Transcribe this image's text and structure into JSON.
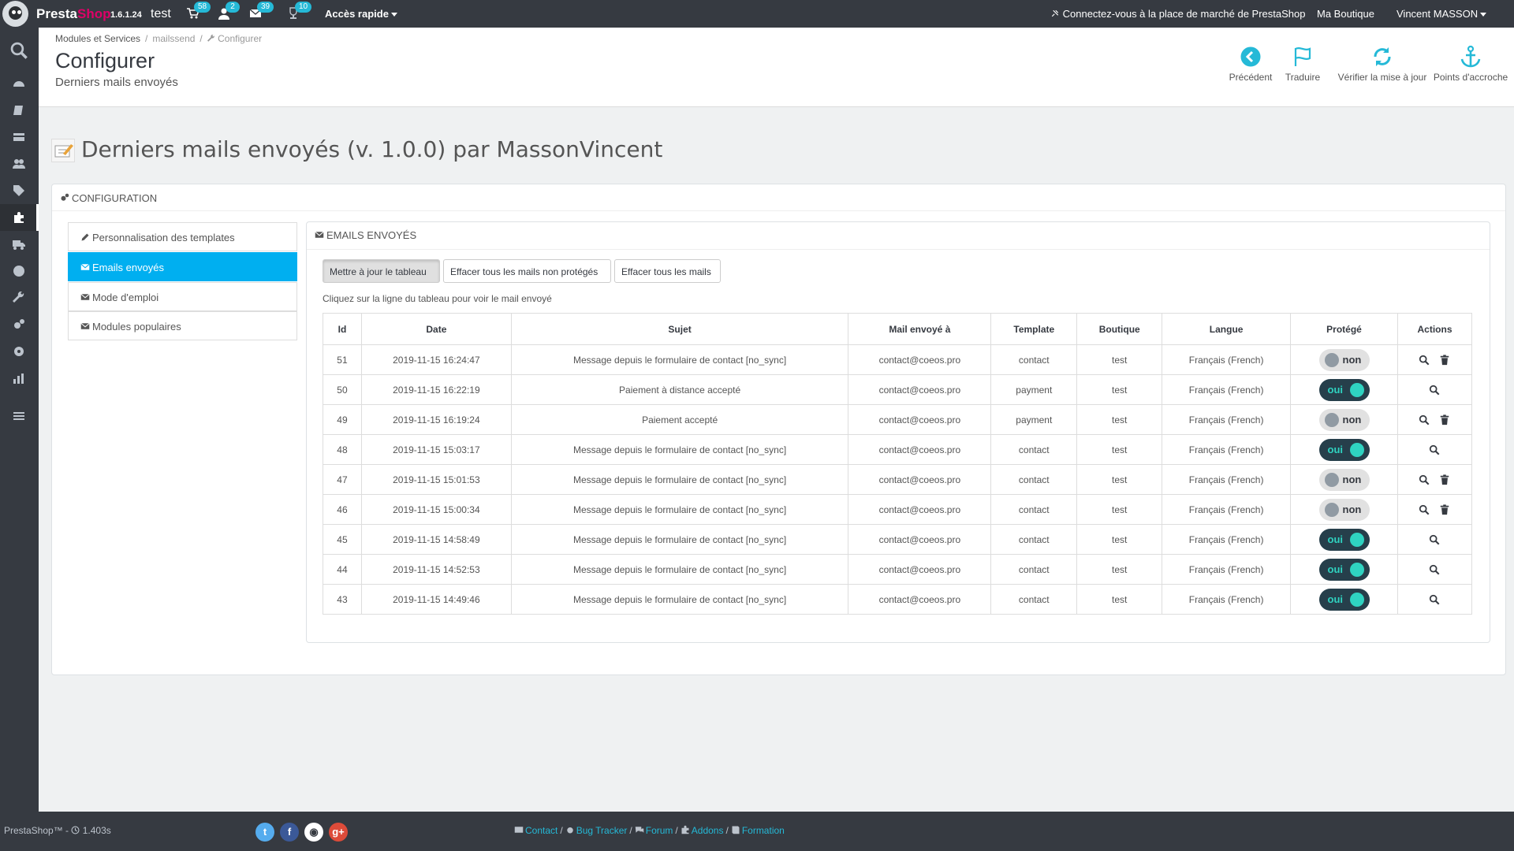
{
  "topbar": {
    "brand_a": "Presta",
    "brand_b": "Shop",
    "version": "1.6.1.24",
    "shop": "test",
    "badges": {
      "orders": "58",
      "customers": "2",
      "messages": "39",
      "trophies": "10"
    },
    "quick_access": "Accès rapide",
    "marketplace": "Connectez-vous à la place de marché de PrestaShop",
    "my_shop": "Ma Boutique",
    "user": "Vincent MASSON"
  },
  "sidebar": {
    "icons": [
      "search-icon",
      "dashboard-icon",
      "orders-icon",
      "catalog-icon",
      "customers-icon",
      "price-rules-icon",
      "modules-icon",
      "shipping-icon",
      "localization-icon",
      "preferences-icon",
      "advanced-params-icon",
      "admin-icon",
      "stats-icon",
      "collapse-menu-icon"
    ]
  },
  "breadcrumb": {
    "root": "Modules et Services",
    "module": "mailssend",
    "current": "Configurer"
  },
  "header": {
    "title": "Configurer",
    "subtitle": "Derniers mails envoyés"
  },
  "toolbar": {
    "back": "Précédent",
    "translate": "Traduire",
    "check_update": "Vérifier la mise à jour",
    "hooks": "Points d'accroche"
  },
  "module_title": "Derniers mails envoyés (v. 1.0.0) par MassonVincent",
  "config_panel": {
    "heading": "CONFIGURATION"
  },
  "menu": [
    {
      "label": "Personnalisation des templates",
      "icon": "pencil-icon"
    },
    {
      "label": "Emails envoyés",
      "icon": "envelope-icon"
    },
    {
      "label": "Mode d'emploi",
      "icon": "envelope-icon"
    },
    {
      "label": "Modules populaires",
      "icon": "envelope-icon"
    }
  ],
  "emails_panel": {
    "heading": "EMAILS ENVOYÉS",
    "btn_refresh": "Mettre à jour le tableau",
    "btn_clear_unprotected": "Effacer tous les mails non protégés",
    "btn_clear_all": "Effacer tous les mails",
    "hint": "Cliquez sur la ligne du tableau pour voir le mail envoyé"
  },
  "table": {
    "headers": [
      "Id",
      "Date",
      "Sujet",
      "Mail envoyé à",
      "Template",
      "Boutique",
      "Langue",
      "Protégé",
      "Actions"
    ],
    "switch_on": "oui",
    "switch_off": "non",
    "rows": [
      {
        "id": "51",
        "date": "2019-11-15 16:24:47",
        "subject": "Message depuis le formulaire de contact [no_sync]",
        "to": "contact@coeos.pro",
        "template": "contact",
        "shop": "test",
        "lang": "Français (French)",
        "protected": false
      },
      {
        "id": "50",
        "date": "2019-11-15 16:22:19",
        "subject": "Paiement à distance accepté",
        "to": "contact@coeos.pro",
        "template": "payment",
        "shop": "test",
        "lang": "Français (French)",
        "protected": true
      },
      {
        "id": "49",
        "date": "2019-11-15 16:19:24",
        "subject": "Paiement accepté",
        "to": "contact@coeos.pro",
        "template": "payment",
        "shop": "test",
        "lang": "Français (French)",
        "protected": false
      },
      {
        "id": "48",
        "date": "2019-11-15 15:03:17",
        "subject": "Message depuis le formulaire de contact [no_sync]",
        "to": "contact@coeos.pro",
        "template": "contact",
        "shop": "test",
        "lang": "Français (French)",
        "protected": true
      },
      {
        "id": "47",
        "date": "2019-11-15 15:01:53",
        "subject": "Message depuis le formulaire de contact [no_sync]",
        "to": "contact@coeos.pro",
        "template": "contact",
        "shop": "test",
        "lang": "Français (French)",
        "protected": false
      },
      {
        "id": "46",
        "date": "2019-11-15 15:00:34",
        "subject": "Message depuis le formulaire de contact [no_sync]",
        "to": "contact@coeos.pro",
        "template": "contact",
        "shop": "test",
        "lang": "Français (French)",
        "protected": false
      },
      {
        "id": "45",
        "date": "2019-11-15 14:58:49",
        "subject": "Message depuis le formulaire de contact [no_sync]",
        "to": "contact@coeos.pro",
        "template": "contact",
        "shop": "test",
        "lang": "Français (French)",
        "protected": true
      },
      {
        "id": "44",
        "date": "2019-11-15 14:52:53",
        "subject": "Message depuis le formulaire de contact [no_sync]",
        "to": "contact@coeos.pro",
        "template": "contact",
        "shop": "test",
        "lang": "Français (French)",
        "protected": true
      },
      {
        "id": "43",
        "date": "2019-11-15 14:49:46",
        "subject": "Message depuis le formulaire de contact [no_sync]",
        "to": "contact@coeos.pro",
        "template": "contact",
        "shop": "test",
        "lang": "Français (French)",
        "protected": true
      }
    ]
  },
  "footer": {
    "brand": "PrestaShop™ -",
    "load_time": "1.403s",
    "social": [
      {
        "name": "twitter-icon",
        "glyph": "t",
        "color": "#55acee"
      },
      {
        "name": "facebook-icon",
        "glyph": "f",
        "color": "#3b5998"
      },
      {
        "name": "github-icon",
        "glyph": "◉",
        "color": "#ffffff"
      },
      {
        "name": "google-plus-icon",
        "glyph": "g+",
        "color": "#dd4b39"
      }
    ],
    "links": [
      {
        "label": "Contact",
        "icon": "envelope-icon"
      },
      {
        "label": "Bug Tracker",
        "icon": "bug-icon"
      },
      {
        "label": "Forum",
        "icon": "comments-icon"
      },
      {
        "label": "Addons",
        "icon": "puzzle-icon"
      },
      {
        "label": "Formation",
        "icon": "book-icon"
      }
    ]
  },
  "colors": {
    "accent": "#25b9d7",
    "active_menu": "#00aff0",
    "topbar": "#363a41",
    "switch_on": "#263f4b",
    "switch_knob_on": "#2fd3c1"
  }
}
